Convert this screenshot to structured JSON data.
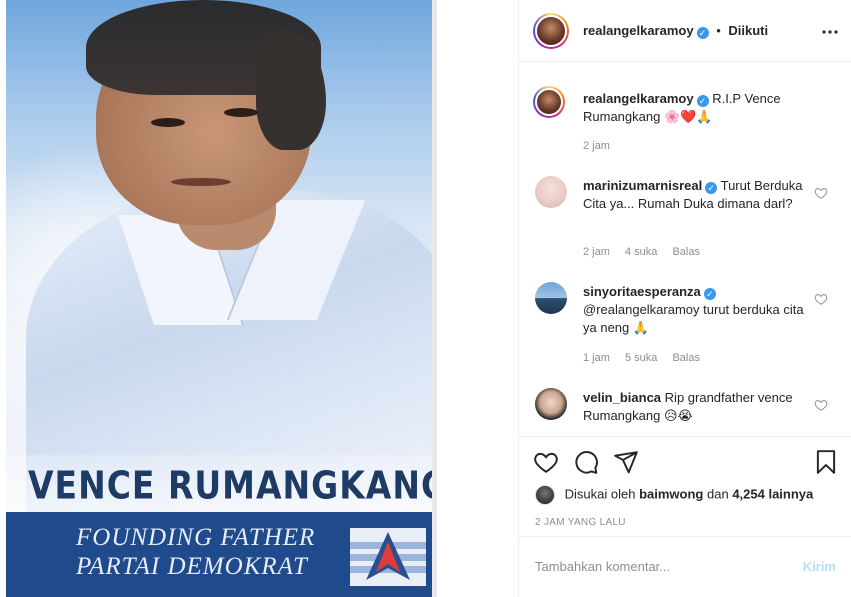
{
  "post_image": {
    "name_text": "VENCE RUMANGKANG",
    "tagline_line1": "FOUNDING FATHER",
    "tagline_line2": "PARTAI DEMOKRAT"
  },
  "header": {
    "username": "realangelkaramoy",
    "separator": "•",
    "follow_status": "Diikuti",
    "more_icon": "more-horizontal-icon"
  },
  "caption": {
    "username": "realangelkaramoy",
    "text": "R.I.P Vence Rumangkang 🌸❤️🙏",
    "time": "2 jam"
  },
  "comments": [
    {
      "username": "marinizumarnisreal",
      "verified": true,
      "text": "Turut Berduka Cita ya... Rumah Duka dimana darl?",
      "time": "2 jam",
      "likes": "4 suka",
      "reply": "Balas"
    },
    {
      "username": "sinyoritaesperanza",
      "verified": true,
      "text": "@realangelkaramoy turut berduka cita ya neng 🙏",
      "time": "1 jam",
      "likes": "5 suka",
      "reply": "Balas"
    },
    {
      "username": "velin_bianca",
      "verified": false,
      "text": "Rip grandfather vence Rumangkang 😥😭"
    }
  ],
  "actions": {
    "like_icon": "heart-icon",
    "comment_icon": "comment-icon",
    "share_icon": "share-icon",
    "save_icon": "bookmark-icon"
  },
  "likes": {
    "prefix": "Disukai oleh",
    "user": "baimwong",
    "conjunction": "dan",
    "count": "4,254 lainnya"
  },
  "timestamp": "2 JAM YANG LALU",
  "add_comment": {
    "placeholder": "Tambahkan komentar...",
    "post_label": "Kirim"
  },
  "colors": {
    "verified": "#3897f0",
    "post_button_disabled": "#b2dffc",
    "poster_band": "#1f4a8c",
    "poster_name": "#1e3b66"
  }
}
